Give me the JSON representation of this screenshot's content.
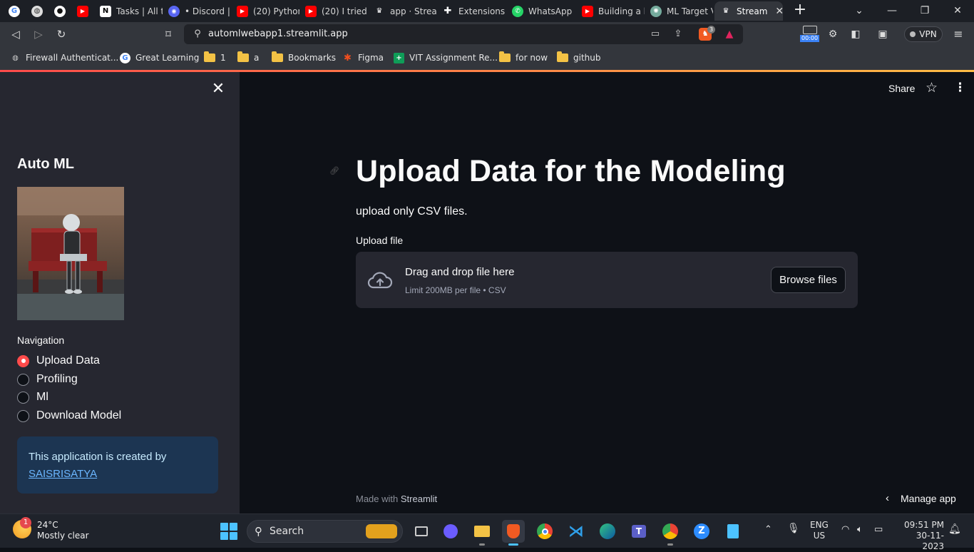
{
  "browser": {
    "tabs": [
      {
        "label": "",
        "icon": "google-icon",
        "color": "#ffffff"
      },
      {
        "label": "",
        "icon": "globe-icon",
        "color": "#ffffff"
      },
      {
        "label": "",
        "icon": "github-icon",
        "color": "#ffffff"
      },
      {
        "label": "",
        "icon": "youtube-icon",
        "color": "#ff0000"
      },
      {
        "label": "Tasks | All t",
        "icon": "notion-icon",
        "color": "#ffffff"
      },
      {
        "label": "• Discord | ",
        "icon": "discord-icon",
        "color": "#5865f2"
      },
      {
        "label": "(20) Python",
        "icon": "youtube-icon",
        "color": "#ff0000"
      },
      {
        "label": "(20) I tried",
        "icon": "youtube-icon",
        "color": "#ff0000"
      },
      {
        "label": "app · Strear",
        "icon": "streamlit-icon",
        "color": "#ffffff"
      },
      {
        "label": "Extensions",
        "icon": "puzzle-icon",
        "color": "#ffffff"
      },
      {
        "label": "WhatsApp",
        "icon": "whatsapp-icon",
        "color": "#25d366"
      },
      {
        "label": "Building a l",
        "icon": "youtube-icon",
        "color": "#ff0000"
      },
      {
        "label": "ML Target V",
        "icon": "chatgpt-icon",
        "color": "#74aa9c"
      },
      {
        "label": "Stream",
        "icon": "streamlit-icon",
        "color": "#ffffff"
      }
    ],
    "url": "automlwebapp1.streamlit.app",
    "vpn_label": "VPN",
    "timer": "00:00",
    "brave_badge": "3",
    "bookmarks": [
      {
        "label": "Firewall Authenticat...",
        "icon": "globe-icon"
      },
      {
        "label": "Great Learning",
        "icon": "google-icon"
      },
      {
        "label": "1",
        "icon": "folder-icon"
      },
      {
        "label": "a",
        "icon": "folder-icon"
      },
      {
        "label": "Bookmarks",
        "icon": "folder-icon"
      },
      {
        "label": "Figma",
        "icon": "figma-icon"
      },
      {
        "label": "VIT Assignment Re...",
        "icon": "sheets-icon"
      },
      {
        "label": "for now",
        "icon": "folder-icon"
      },
      {
        "label": "github",
        "icon": "folder-icon"
      }
    ]
  },
  "sidebar": {
    "title": "Auto ML",
    "nav_label": "Navigation",
    "options": [
      {
        "label": "Upload Data",
        "selected": true
      },
      {
        "label": "Profiling",
        "selected": false
      },
      {
        "label": "Ml",
        "selected": false
      },
      {
        "label": "Download Model",
        "selected": false
      }
    ],
    "info_text": "This application is created by",
    "info_link": "SAISRISATYA"
  },
  "main": {
    "share": "Share",
    "title": "Upload Data for the Modeling",
    "subtitle": "upload only CSV files.",
    "upload_label": "Upload file",
    "drop_title": "Drag and drop file here",
    "drop_sub": "Limit 200MB per file • CSV",
    "browse": "Browse files",
    "footer_prefix": "Made with",
    "footer_brand": "Streamlit",
    "manage": "Manage app"
  },
  "taskbar": {
    "temp": "24°C",
    "weather": "Mostly clear",
    "weather_badge": "1",
    "search": "Search",
    "lang1": "ENG",
    "lang2": "US",
    "time": "09:51 PM",
    "date": "30-11-2023"
  },
  "colors": {
    "accent": "#ff4b4b",
    "sidebar_bg": "#262730",
    "main_bg": "#0e1117",
    "info_bg": "#1c3552"
  }
}
